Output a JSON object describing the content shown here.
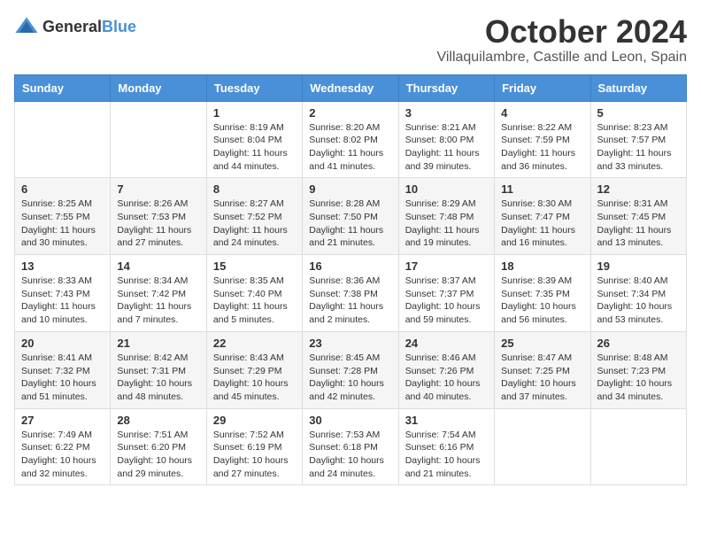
{
  "header": {
    "logo_general": "General",
    "logo_blue": "Blue",
    "month_title": "October 2024",
    "location": "Villaquilambre, Castille and Leon, Spain"
  },
  "days_of_week": [
    "Sunday",
    "Monday",
    "Tuesday",
    "Wednesday",
    "Thursday",
    "Friday",
    "Saturday"
  ],
  "weeks": [
    [
      {
        "day": "",
        "info": ""
      },
      {
        "day": "",
        "info": ""
      },
      {
        "day": "1",
        "info": "Sunrise: 8:19 AM\nSunset: 8:04 PM\nDaylight: 11 hours and 44 minutes."
      },
      {
        "day": "2",
        "info": "Sunrise: 8:20 AM\nSunset: 8:02 PM\nDaylight: 11 hours and 41 minutes."
      },
      {
        "day": "3",
        "info": "Sunrise: 8:21 AM\nSunset: 8:00 PM\nDaylight: 11 hours and 39 minutes."
      },
      {
        "day": "4",
        "info": "Sunrise: 8:22 AM\nSunset: 7:59 PM\nDaylight: 11 hours and 36 minutes."
      },
      {
        "day": "5",
        "info": "Sunrise: 8:23 AM\nSunset: 7:57 PM\nDaylight: 11 hours and 33 minutes."
      }
    ],
    [
      {
        "day": "6",
        "info": "Sunrise: 8:25 AM\nSunset: 7:55 PM\nDaylight: 11 hours and 30 minutes."
      },
      {
        "day": "7",
        "info": "Sunrise: 8:26 AM\nSunset: 7:53 PM\nDaylight: 11 hours and 27 minutes."
      },
      {
        "day": "8",
        "info": "Sunrise: 8:27 AM\nSunset: 7:52 PM\nDaylight: 11 hours and 24 minutes."
      },
      {
        "day": "9",
        "info": "Sunrise: 8:28 AM\nSunset: 7:50 PM\nDaylight: 11 hours and 21 minutes."
      },
      {
        "day": "10",
        "info": "Sunrise: 8:29 AM\nSunset: 7:48 PM\nDaylight: 11 hours and 19 minutes."
      },
      {
        "day": "11",
        "info": "Sunrise: 8:30 AM\nSunset: 7:47 PM\nDaylight: 11 hours and 16 minutes."
      },
      {
        "day": "12",
        "info": "Sunrise: 8:31 AM\nSunset: 7:45 PM\nDaylight: 11 hours and 13 minutes."
      }
    ],
    [
      {
        "day": "13",
        "info": "Sunrise: 8:33 AM\nSunset: 7:43 PM\nDaylight: 11 hours and 10 minutes."
      },
      {
        "day": "14",
        "info": "Sunrise: 8:34 AM\nSunset: 7:42 PM\nDaylight: 11 hours and 7 minutes."
      },
      {
        "day": "15",
        "info": "Sunrise: 8:35 AM\nSunset: 7:40 PM\nDaylight: 11 hours and 5 minutes."
      },
      {
        "day": "16",
        "info": "Sunrise: 8:36 AM\nSunset: 7:38 PM\nDaylight: 11 hours and 2 minutes."
      },
      {
        "day": "17",
        "info": "Sunrise: 8:37 AM\nSunset: 7:37 PM\nDaylight: 10 hours and 59 minutes."
      },
      {
        "day": "18",
        "info": "Sunrise: 8:39 AM\nSunset: 7:35 PM\nDaylight: 10 hours and 56 minutes."
      },
      {
        "day": "19",
        "info": "Sunrise: 8:40 AM\nSunset: 7:34 PM\nDaylight: 10 hours and 53 minutes."
      }
    ],
    [
      {
        "day": "20",
        "info": "Sunrise: 8:41 AM\nSunset: 7:32 PM\nDaylight: 10 hours and 51 minutes."
      },
      {
        "day": "21",
        "info": "Sunrise: 8:42 AM\nSunset: 7:31 PM\nDaylight: 10 hours and 48 minutes."
      },
      {
        "day": "22",
        "info": "Sunrise: 8:43 AM\nSunset: 7:29 PM\nDaylight: 10 hours and 45 minutes."
      },
      {
        "day": "23",
        "info": "Sunrise: 8:45 AM\nSunset: 7:28 PM\nDaylight: 10 hours and 42 minutes."
      },
      {
        "day": "24",
        "info": "Sunrise: 8:46 AM\nSunset: 7:26 PM\nDaylight: 10 hours and 40 minutes."
      },
      {
        "day": "25",
        "info": "Sunrise: 8:47 AM\nSunset: 7:25 PM\nDaylight: 10 hours and 37 minutes."
      },
      {
        "day": "26",
        "info": "Sunrise: 8:48 AM\nSunset: 7:23 PM\nDaylight: 10 hours and 34 minutes."
      }
    ],
    [
      {
        "day": "27",
        "info": "Sunrise: 7:49 AM\nSunset: 6:22 PM\nDaylight: 10 hours and 32 minutes."
      },
      {
        "day": "28",
        "info": "Sunrise: 7:51 AM\nSunset: 6:20 PM\nDaylight: 10 hours and 29 minutes."
      },
      {
        "day": "29",
        "info": "Sunrise: 7:52 AM\nSunset: 6:19 PM\nDaylight: 10 hours and 27 minutes."
      },
      {
        "day": "30",
        "info": "Sunrise: 7:53 AM\nSunset: 6:18 PM\nDaylight: 10 hours and 24 minutes."
      },
      {
        "day": "31",
        "info": "Sunrise: 7:54 AM\nSunset: 6:16 PM\nDaylight: 10 hours and 21 minutes."
      },
      {
        "day": "",
        "info": ""
      },
      {
        "day": "",
        "info": ""
      }
    ]
  ]
}
